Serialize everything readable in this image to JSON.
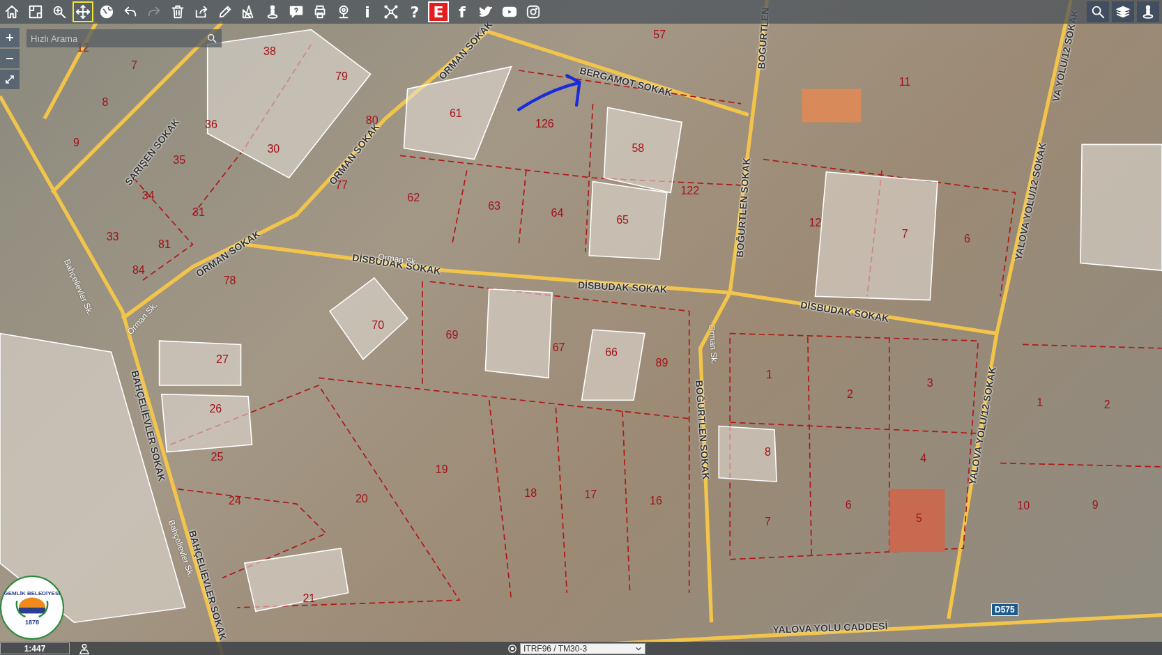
{
  "toolbar": {
    "tools": [
      {
        "kind": "icon",
        "selected": false,
        "disabled": false
      },
      {
        "kind": "icon",
        "selected": false,
        "disabled": false
      },
      {
        "kind": "icon",
        "selected": false,
        "disabled": false
      },
      {
        "kind": "icon",
        "selected": true,
        "disabled": false
      },
      {
        "kind": "icon",
        "selected": false,
        "disabled": false
      },
      {
        "kind": "icon",
        "selected": false,
        "disabled": false
      },
      {
        "kind": "icon",
        "selected": false,
        "disabled": true
      },
      {
        "kind": "icon",
        "selected": false,
        "disabled": false
      },
      {
        "kind": "icon",
        "selected": false,
        "disabled": false
      },
      {
        "kind": "icon",
        "selected": false,
        "disabled": false
      },
      {
        "kind": "icon",
        "selected": false,
        "disabled": false
      },
      {
        "kind": "icon",
        "selected": false,
        "disabled": false
      },
      {
        "kind": "icon",
        "selected": false,
        "disabled": false
      },
      {
        "kind": "icon",
        "selected": false,
        "disabled": false
      },
      {
        "kind": "icon",
        "selected": false,
        "disabled": false
      },
      {
        "kind": "text",
        "label": "i",
        "selected": false,
        "disabled": false
      },
      {
        "kind": "icon",
        "selected": false,
        "disabled": false
      },
      {
        "kind": "text",
        "label": "?",
        "selected": false,
        "disabled": false
      },
      {
        "kind": "badge",
        "label": "E",
        "selected": false,
        "disabled": false
      },
      {
        "kind": "text",
        "label": "f",
        "selected": false,
        "disabled": false
      },
      {
        "kind": "icon",
        "selected": false,
        "disabled": false
      },
      {
        "kind": "icon",
        "selected": false,
        "disabled": false
      },
      {
        "kind": "icon",
        "selected": false,
        "disabled": false
      }
    ]
  },
  "search": {
    "placeholder": "Hızlı Arama"
  },
  "map": {
    "parcels": [
      {
        "label": "57"
      },
      {
        "label": "12"
      },
      {
        "label": "7"
      },
      {
        "label": "38"
      },
      {
        "label": "79"
      },
      {
        "label": "8"
      },
      {
        "label": "36"
      },
      {
        "label": "80"
      },
      {
        "label": "61"
      },
      {
        "label": "126"
      },
      {
        "label": "9"
      },
      {
        "label": "30"
      },
      {
        "label": "35"
      },
      {
        "label": "58"
      },
      {
        "label": "11"
      },
      {
        "label": "34"
      },
      {
        "label": "77"
      },
      {
        "label": "62"
      },
      {
        "label": "63"
      },
      {
        "label": "64"
      },
      {
        "label": "122"
      },
      {
        "label": "65"
      },
      {
        "label": "12"
      },
      {
        "label": "7"
      },
      {
        "label": "6"
      },
      {
        "label": "31"
      },
      {
        "label": "33"
      },
      {
        "label": "81"
      },
      {
        "label": "84"
      },
      {
        "label": "78"
      },
      {
        "label": "70"
      },
      {
        "label": "69"
      },
      {
        "label": "67"
      },
      {
        "label": "66"
      },
      {
        "label": "89"
      },
      {
        "label": "27"
      },
      {
        "label": "26"
      },
      {
        "label": "25"
      },
      {
        "label": "19"
      },
      {
        "label": "24"
      },
      {
        "label": "20"
      },
      {
        "label": "18"
      },
      {
        "label": "17"
      },
      {
        "label": "16"
      },
      {
        "label": "21"
      },
      {
        "label": "1"
      },
      {
        "label": "2"
      },
      {
        "label": "3"
      },
      {
        "label": "8"
      },
      {
        "label": "4"
      },
      {
        "label": "6"
      },
      {
        "label": "7"
      },
      {
        "label": "5"
      },
      {
        "label": "1"
      },
      {
        "label": "2"
      },
      {
        "label": "10"
      },
      {
        "label": "9"
      }
    ],
    "streets": [
      {
        "label": "BERGAMOT SOKAK",
        "kind": "major"
      },
      {
        "label": "ORMAN SOKAK",
        "kind": "major"
      },
      {
        "label": "ORMAN SOKAK",
        "kind": "major"
      },
      {
        "label": "ORMAN SOKAK",
        "kind": "major"
      },
      {
        "label": "SARIŞEN SOKAK",
        "kind": "major"
      },
      {
        "label": "DİSBUDAK SOKAK",
        "kind": "major"
      },
      {
        "label": "DİSBUDAK SOKAK",
        "kind": "major"
      },
      {
        "label": "DİSBUDAK SOKAK",
        "kind": "major"
      },
      {
        "label": "BOĞURTLEN SOKAK",
        "kind": "major"
      },
      {
        "label": "BOĞURTLEN",
        "kind": "major"
      },
      {
        "label": "YALOVA YOLU/12 SOKAK",
        "kind": "major"
      },
      {
        "label": "YALOVA YOLU/12 SOKAK",
        "kind": "major"
      },
      {
        "label": "VA YOLU/12 SOKAK",
        "kind": "major"
      },
      {
        "label": "BAHÇELİEVLER SOKAK",
        "kind": "major"
      },
      {
        "label": "BAHÇELİEVLER SOKAK",
        "kind": "major"
      },
      {
        "label": "YALOVA YOLU CADDESİ",
        "kind": "major"
      },
      {
        "label": "BOĞURTLEN SOKAK",
        "kind": "major"
      },
      {
        "label": "Orman Sk.",
        "kind": "minor"
      },
      {
        "label": "Orman Sk.",
        "kind": "minor"
      },
      {
        "label": "Orman Sk.",
        "kind": "minor"
      },
      {
        "label": "Bahçelievler Sk.",
        "kind": "minor"
      },
      {
        "label": "Bahçelievler Sk.",
        "kind": "minor"
      }
    ],
    "road_shield": "D575",
    "logo": {
      "name": "GEMLİK BELEDİYESİ",
      "year": "1878"
    }
  },
  "status_bar": {
    "scale": "1:447",
    "projection": "ITRF96 / TM30-3"
  }
}
